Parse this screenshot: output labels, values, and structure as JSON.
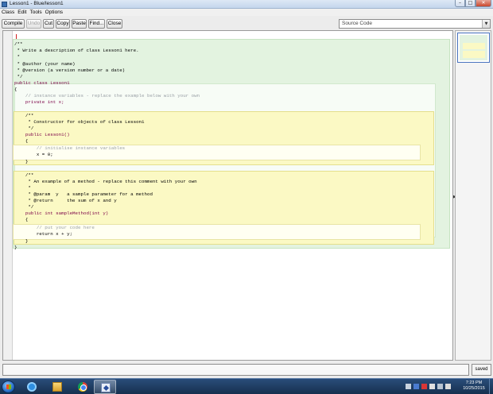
{
  "window": {
    "title": "Lesson1 - Blue/lesson1"
  },
  "menu": [
    "Class",
    "Edit",
    "Tools",
    "Options"
  ],
  "toolbar": {
    "buttons": [
      {
        "label": "Compile",
        "enabled": true
      },
      {
        "label": "Undo",
        "enabled": false
      },
      {
        "label": "Cut",
        "enabled": true
      },
      {
        "label": "Copy",
        "enabled": true
      },
      {
        "label": "Paste",
        "enabled": true
      },
      {
        "label": "Find...",
        "enabled": true
      },
      {
        "label": "Close",
        "enabled": true
      }
    ],
    "view_selector": {
      "selected": "Source Code"
    }
  },
  "code": {
    "lines": {
      "l1": "/**",
      "l2": " * Write a description of class Lesson1 here.",
      "l3": " *",
      "l4": " * @author (your name)",
      "l5": " * @version (a version number or a date)",
      "l6": " */",
      "l7": "public class Lesson1",
      "l8": "{",
      "l9": "    // instance variables - replace the example below with your own",
      "l10": "    private int x;",
      "l11": "    /**",
      "l12": "     * Constructor for objects of class Lesson1",
      "l13": "     */",
      "l14": "    public Lesson1()",
      "l15": "    {",
      "l16": "        // initialise instance variables",
      "l17": "        x = 0;",
      "l18": "    }",
      "l19": "    /**",
      "l20": "     * An example of a method - replace this comment with your own",
      "l21": "     *",
      "l22": "     * @param  y   a sample parameter for a method",
      "l23": "     * @return     the sum of x and y",
      "l24": "     */",
      "l25": "    public int sampleMethod(int y)",
      "l26": "    {",
      "l27": "        // put your code here",
      "l28": "        return x + y;",
      "l29": "    }",
      "l30": "}"
    }
  },
  "status": {
    "message": "",
    "saved": "saved"
  },
  "taskbar": {
    "clock_time": "7:23 PM",
    "clock_date": "10/25/2015"
  },
  "colors": {
    "class_scope": "#e3f3e0",
    "method_scope": "#fbf9c4",
    "keyword": "#7b0047",
    "comment": "#9aa0a6"
  }
}
